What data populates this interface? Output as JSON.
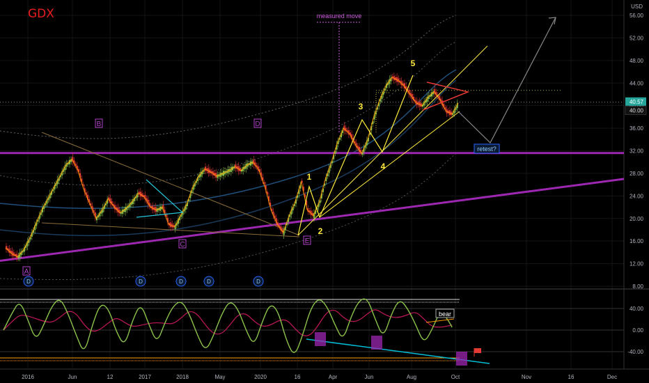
{
  "header": {
    "ticker": "GDX",
    "currency": "USD"
  },
  "colors": {
    "background": "#000000",
    "ticker": "#e81c1c",
    "wave_label": "#ffeb3b",
    "correction_label": "#b040c8",
    "trendline_magenta": "#9c27b0",
    "rsi_line": "#8bc34a",
    "rsi_signal": "#c2185b",
    "divergence_line": "#00bcd4",
    "current_price_box": "#26a69a",
    "candle_up": "#8bc34a",
    "candle_down": "#e53935"
  },
  "chart_data": [
    {
      "type": "line",
      "name": "price",
      "y_axis_ticks": [
        "56.00",
        "52.00",
        "48.00",
        "44.00",
        "40.00",
        "36.00",
        "32.00",
        "28.00",
        "24.00",
        "20.00",
        "16.00",
        "12.00",
        "8.00"
      ],
      "ylim": [
        8,
        58
      ],
      "x_ticks": [
        "2016",
        "Jun",
        "12",
        "2017",
        "2018",
        "May",
        "2020",
        "16",
        "Apr",
        "Jun",
        "Aug",
        "Oct",
        "Nov",
        "16",
        "Dec"
      ],
      "current_price": "40.57",
      "level_label": "40.00",
      "series": [
        {
          "values": [
            14.8,
            13.8,
            13.2,
            14.5,
            16.5,
            19.0,
            21.5,
            23.5,
            25.5,
            27.5,
            29.5,
            30.5,
            28.5,
            25.0,
            22.5,
            20.0,
            21.5,
            23.5,
            22.0,
            21.0,
            21.8,
            23.0,
            24.5,
            23.8,
            22.0,
            21.5,
            22.0,
            19.0,
            18.5,
            20.5,
            22.5,
            25.5,
            27.5,
            28.8,
            28.2,
            27.5,
            28.0,
            28.5,
            29.2,
            28.5,
            29.5,
            30.0,
            28.5,
            25.5,
            21.5,
            19.0,
            17.5,
            20.5,
            23.0,
            26.5,
            21.5,
            20.5,
            23.0,
            27.0,
            30.0,
            33.5,
            36.0,
            35.0,
            33.0,
            31.5,
            34.0,
            38.0,
            41.0,
            43.5,
            45.0,
            44.5,
            43.5,
            42.0,
            40.5,
            40.0,
            41.5,
            42.5,
            41.0,
            39.0,
            38.5,
            40.5
          ]
        }
      ],
      "annotations": {
        "wave_labels": [
          "1",
          "2",
          "3",
          "4",
          "5"
        ],
        "correction_labels": [
          "A",
          "B",
          "C",
          "D",
          "E"
        ],
        "event_markers": [
          "D",
          "D",
          "D",
          "D",
          "D"
        ],
        "measured_move": "measured move",
        "retest": "retest?"
      }
    },
    {
      "type": "line",
      "name": "rsi-panel",
      "y_axis_ticks": [
        "40.00",
        "0.00",
        "-40.00"
      ],
      "ylim": [
        -60,
        60
      ],
      "series": [
        {
          "values": [
            0,
            30,
            55,
            20,
            -20,
            10,
            45,
            60,
            30,
            -10,
            -45,
            10,
            50,
            40,
            -5,
            -30,
            20,
            50,
            10,
            -25,
            15,
            45,
            55,
            30,
            -10,
            -40,
            -10,
            30,
            55,
            40,
            0,
            -30,
            15,
            50,
            35,
            -20,
            -50,
            -10,
            40,
            60,
            45,
            10,
            -20,
            25,
            55,
            60,
            20,
            -15,
            30,
            58,
            40,
            10,
            -25,
            0,
            35,
            20,
            -10
          ]
        }
      ],
      "annotations": {
        "divergence_label": "bear"
      }
    }
  ]
}
